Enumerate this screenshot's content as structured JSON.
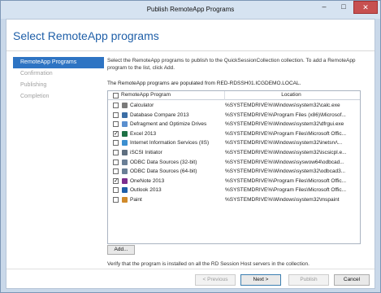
{
  "window": {
    "title": "Publish RemoteApp Programs",
    "minimize": "–",
    "maximize": "□",
    "close": "✕"
  },
  "header": {
    "heading": "Select RemoteApp programs"
  },
  "nav": {
    "items": [
      {
        "label": "RemoteApp Programs",
        "active": true
      },
      {
        "label": "Confirmation",
        "active": false
      },
      {
        "label": "Publishing",
        "active": false
      },
      {
        "label": "Completion",
        "active": false
      }
    ]
  },
  "content": {
    "intro": "Select the RemoteApp programs to publish to the QuickSessionCollection collection. To add a RemoteApp program to the list, click Add.",
    "populated": "The RemoteApp programs are populated from RED-RDSSH01.ICGDEMO.LOCAL.",
    "columns": {
      "program": "RemoteApp Program",
      "location": "Location"
    },
    "rows": [
      {
        "name": "Calculator",
        "location": "%SYSTEMDRIVE%\\Windows\\system32\\calc.exe",
        "checked": false,
        "icon": "calculator-icon"
      },
      {
        "name": "Database Compare 2013",
        "location": "%SYSTEMDRIVE%\\Program Files (x86)\\Microsof...",
        "checked": false,
        "icon": "database-compare-icon"
      },
      {
        "name": "Defragment and Optimize Drives",
        "location": "%SYSTEMDRIVE%\\Windows\\system32\\dfrgui.exe",
        "checked": false,
        "icon": "defragment-icon"
      },
      {
        "name": "Excel 2013",
        "location": "%SYSTEMDRIVE%\\Program Files\\Microsoft Offic...",
        "checked": true,
        "icon": "excel-icon"
      },
      {
        "name": "Internet Information Services (IIS)",
        "location": "%SYSTEMDRIVE%\\Windows\\system32\\inetsrv\\...",
        "checked": false,
        "icon": "iis-icon"
      },
      {
        "name": "iSCSI Initiator",
        "location": "%SYSTEMDRIVE%\\Windows\\system32\\iscsicpl.e...",
        "checked": false,
        "icon": "iscsi-icon"
      },
      {
        "name": "ODBC Data Sources (32-bit)",
        "location": "%SYSTEMDRIVE%\\Windows\\syswow64\\odbcad...",
        "checked": false,
        "icon": "odbc-icon"
      },
      {
        "name": "ODBC Data Sources (64-bit)",
        "location": "%SYSTEMDRIVE%\\Windows\\system32\\odbcad3...",
        "checked": false,
        "icon": "odbc-icon"
      },
      {
        "name": "OneNote 2013",
        "location": "%SYSTEMDRIVE%\\Program Files\\Microsoft Offic...",
        "checked": true,
        "icon": "onenote-icon"
      },
      {
        "name": "Outlook 2013",
        "location": "%SYSTEMDRIVE%\\Program Files\\Microsoft Offic...",
        "checked": false,
        "icon": "outlook-icon"
      },
      {
        "name": "Paint",
        "location": "%SYSTEMDRIVE%\\Windows\\system32\\mspaint",
        "checked": false,
        "icon": "paint-icon"
      }
    ],
    "check_mark": "✓",
    "add_label": "Add...",
    "verify": "Verify that the program is installed on all the RD Session Host servers in the collection."
  },
  "footer": {
    "previous": "< Previous",
    "next": "Next >",
    "publish": "Publish",
    "cancel": "Cancel"
  },
  "colors": {
    "accent": "#2e74c3",
    "heading": "#1f5fa8",
    "close": "#c75050"
  }
}
